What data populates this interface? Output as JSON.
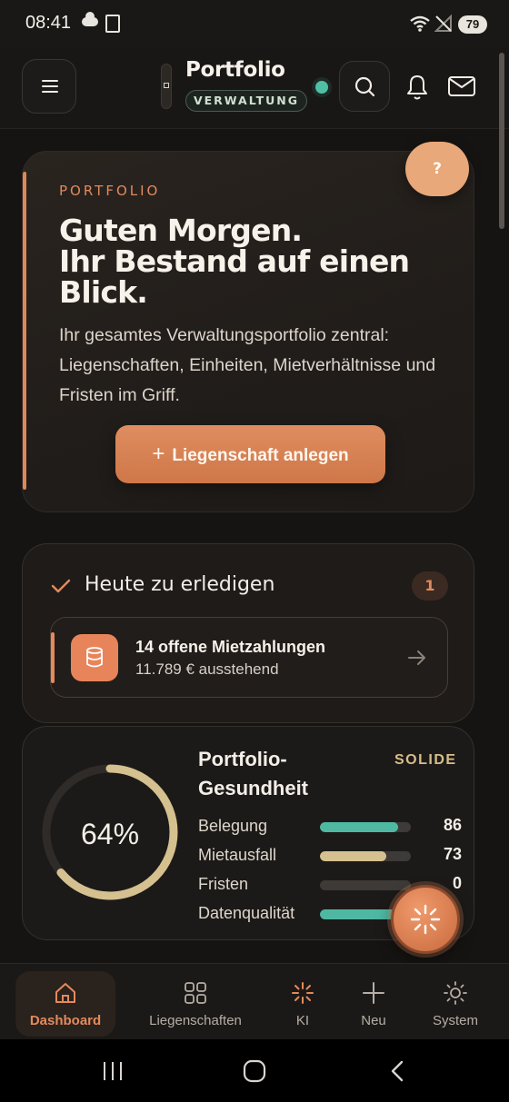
{
  "status_bar": {
    "time": "08:41",
    "battery": "79"
  },
  "header": {
    "title": "Portfolio",
    "badge": "VERWALTUNG"
  },
  "hero": {
    "eyebrow": "PORTFOLIO",
    "headline_line1": "Guten Morgen.",
    "headline_line2": "Ihr Bestand auf einen",
    "headline_line3": "Blick.",
    "description": "Ihr gesamtes Verwaltungsportfolio zentral: Liegenschaften, Einheiten, Mietverhältnisse und Fristen im Griff.",
    "cta_label": "Liegenschaft anlegen",
    "help_label": "?"
  },
  "tasks": {
    "title": "Heute zu erledigen",
    "count": "1",
    "items": [
      {
        "title": "14 offene Mietzahlungen",
        "subtitle": "11.789 € ausstehend"
      }
    ]
  },
  "health": {
    "title_line1": "Portfolio-",
    "title_line2": "Gesundheit",
    "badge": "SOLIDE",
    "score_label": "64%",
    "score": 0.64,
    "metrics": [
      {
        "label": "Belegung",
        "value": "86",
        "fraction": 0.86,
        "color": "#4fb8a3"
      },
      {
        "label": "Mietausfall",
        "value": "73",
        "fraction": 0.73,
        "color": "#d5c08f"
      },
      {
        "label": "Fristen",
        "value": "0",
        "fraction": 0.0,
        "color": "#4fb8a3"
      },
      {
        "label": "Datenqualität",
        "value": "",
        "fraction": 0.9,
        "color": "#4fb8a3"
      }
    ]
  },
  "colors": {
    "accent": "#e38a5c",
    "teal": "#4fb8a3",
    "gold": "#d5c08f"
  },
  "bottom_nav": [
    {
      "label": "Dashboard",
      "icon": "home-icon",
      "active": true
    },
    {
      "label": "Liegenschaften",
      "icon": "grid-icon",
      "active": false
    },
    {
      "label": "KI",
      "icon": "sparkle-icon",
      "active": false
    },
    {
      "label": "Neu",
      "icon": "plus-icon",
      "active": false
    },
    {
      "label": "System",
      "icon": "sun-icon",
      "active": false
    }
  ]
}
